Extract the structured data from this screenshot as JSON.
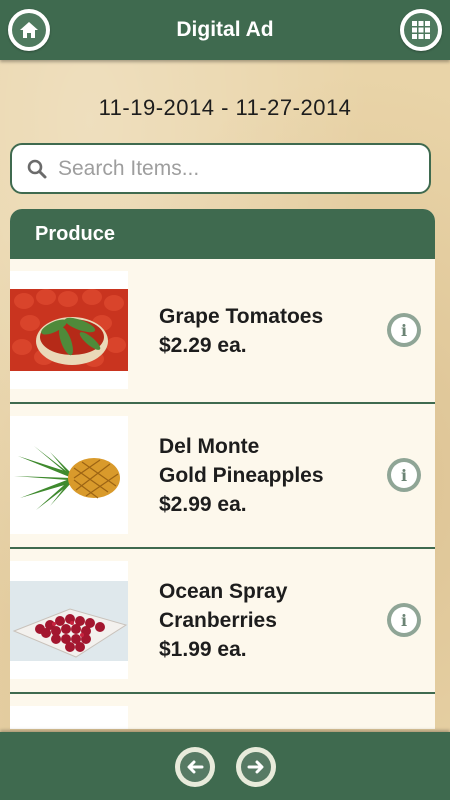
{
  "header": {
    "title": "Digital Ad",
    "home_icon": "home-icon",
    "grid_icon": "grid-menu-icon"
  },
  "date_range": "11-19-2014 - 11-27-2014",
  "search": {
    "placeholder": "Search Items...",
    "value": ""
  },
  "category": {
    "title": "Produce",
    "items": [
      {
        "name": "Grape Tomatoes",
        "price": "$2.29 ea.",
        "image": "grape-tomatoes-image"
      },
      {
        "name": "Del Monte\nGold Pineapples",
        "price": "$2.99 ea.",
        "image": "pineapple-image"
      },
      {
        "name": "Ocean Spray\nCranberries",
        "price": "$1.99 ea.",
        "image": "cranberries-image"
      },
      {
        "name": "",
        "price": "",
        "image": "partial-item-image"
      }
    ]
  },
  "footer": {
    "prev_icon": "arrow-left-icon",
    "next_icon": "arrow-right-icon"
  },
  "colors": {
    "brand_green": "#3f6a4f",
    "parchment": "#e9d4a8",
    "info_button": "#8fa596"
  }
}
